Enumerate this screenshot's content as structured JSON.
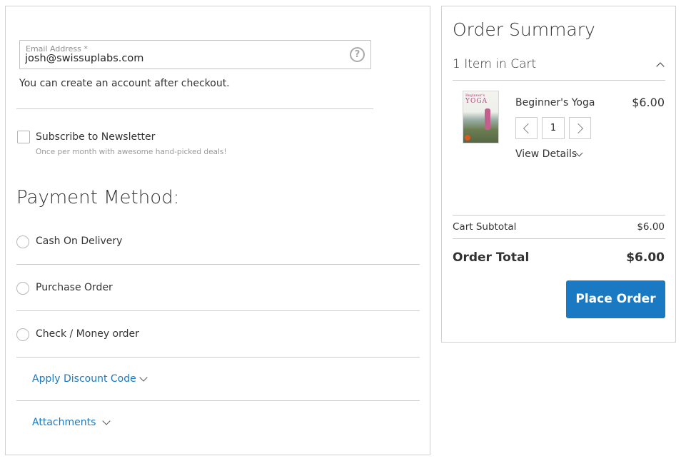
{
  "shipping": {
    "email_label": "Email Address *",
    "email_value": "josh@swissuplabs.com",
    "help_glyph": "?",
    "account_note": "You can create an account after checkout."
  },
  "newsletter": {
    "label": "Subscribe to Newsletter",
    "note": "Once per month with awesome hand-picked deals!",
    "checked": false
  },
  "payment": {
    "title": "Payment Method:",
    "methods": [
      {
        "label": "Cash On Delivery",
        "selected": false
      },
      {
        "label": "Purchase Order",
        "selected": false
      },
      {
        "label": "Check / Money order",
        "selected": false
      }
    ],
    "sections": [
      {
        "label": "Apply Discount Code"
      },
      {
        "label": "Attachments"
      }
    ]
  },
  "summary": {
    "title": "Order Summary",
    "items_in_cart": "1 Item in Cart",
    "item": {
      "name": "Beginner's Yoga",
      "price": "$6.00",
      "qty": "1",
      "view_details": "View Details",
      "thumb_text_small": "Beginner's",
      "thumb_text_big": "YOGA"
    },
    "subtotal_label": "Cart Subtotal",
    "subtotal_value": "$6.00",
    "total_label": "Order Total",
    "total_value": "$6.00",
    "place_order": "Place Order"
  },
  "colors": {
    "accent": "#1979c3",
    "border": "#d1d1d1"
  }
}
